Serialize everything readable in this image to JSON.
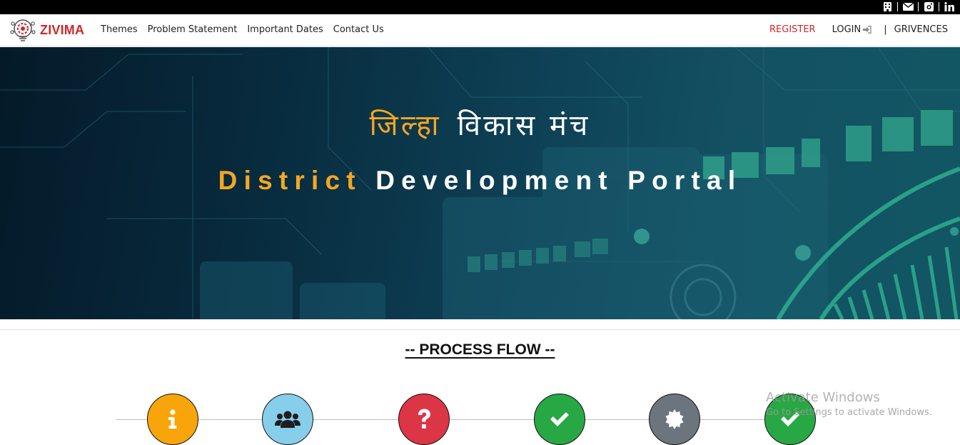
{
  "topbar": {
    "icons": [
      "building-icon",
      "envelope-icon",
      "instagram-icon",
      "linkedin-icon"
    ]
  },
  "brand": {
    "name": "ZIVIMA"
  },
  "nav": {
    "left": [
      "Themes",
      "Problem Statement",
      "Important Dates",
      "Contact Us"
    ],
    "register": "REGISTER",
    "login": "LOGIN",
    "separator": "|",
    "grievances": "GRIVENCES"
  },
  "hero": {
    "hindi_part1": "जिल्हा",
    "hindi_part2": "विकास मंच",
    "english_part1": "District",
    "english_part2": "Development Portal"
  },
  "process": {
    "title": "-- PROCESS FLOW --",
    "steps": [
      {
        "icon": "info-icon",
        "color": "#f8a50c"
      },
      {
        "icon": "users-icon",
        "color": "#87ceeb"
      },
      {
        "icon": "question-icon",
        "color": "#dc3545"
      },
      {
        "icon": "check-icon",
        "color": "#28a745"
      },
      {
        "icon": "gear-badge-icon",
        "color": "#6c757d"
      },
      {
        "icon": "check-icon",
        "color": "#28a745"
      }
    ]
  },
  "watermark": {
    "line1": "Activate Windows",
    "line2": "Go to Settings to activate Windows."
  },
  "colors": {
    "brand_red": "#d0282a",
    "accent_orange": "#f5a623"
  }
}
